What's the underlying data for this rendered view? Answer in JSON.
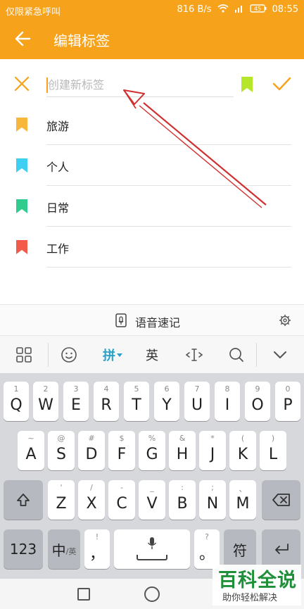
{
  "status_bar": {
    "left_text": "仅限紧急呼叫",
    "speed": "816 B/s",
    "battery": "45",
    "time": "08:55"
  },
  "app_bar": {
    "title": "编辑标签"
  },
  "new_tag": {
    "placeholder": "创建新标签",
    "value": "",
    "flag_color": "#b6e62b"
  },
  "tags": [
    {
      "label": "旅游",
      "color": "#f8b73b"
    },
    {
      "label": "个人",
      "color": "#3dd0f2"
    },
    {
      "label": "日常",
      "color": "#30cc8f"
    },
    {
      "label": "工作",
      "color": "#f25a4c"
    }
  ],
  "voice_bar": {
    "label": "语音速记"
  },
  "ime_toolbar": {
    "pinyin": "拼",
    "english": "英"
  },
  "keyboard": {
    "row1": [
      {
        "hint": "1",
        "key": "Q"
      },
      {
        "hint": "2",
        "key": "W"
      },
      {
        "hint": "3",
        "key": "E"
      },
      {
        "hint": "4",
        "key": "R"
      },
      {
        "hint": "5",
        "key": "T"
      },
      {
        "hint": "6",
        "key": "Y"
      },
      {
        "hint": "7",
        "key": "U"
      },
      {
        "hint": "8",
        "key": "I"
      },
      {
        "hint": "9",
        "key": "O"
      },
      {
        "hint": "0",
        "key": "P"
      }
    ],
    "row2": [
      {
        "hint": "~",
        "key": "A"
      },
      {
        "hint": "@",
        "key": "S"
      },
      {
        "hint": "#",
        "key": "D"
      },
      {
        "hint": "$",
        "key": "F"
      },
      {
        "hint": "%",
        "key": "G"
      },
      {
        "hint": "&",
        "key": "H"
      },
      {
        "hint": "*",
        "key": "J"
      },
      {
        "hint": "(",
        "key": "K"
      },
      {
        "hint": ")",
        "key": "L"
      }
    ],
    "row3": [
      {
        "hint": "'",
        "key": "Z"
      },
      {
        "hint": "/",
        "key": "X"
      },
      {
        "hint": "-",
        "key": "C"
      },
      {
        "hint": "_",
        "key": "V"
      },
      {
        "hint": ":",
        "key": "B"
      },
      {
        "hint": ";",
        "key": "N"
      },
      {
        "hint": "、",
        "key": "M"
      }
    ],
    "num_key": "123",
    "lang_key_main": "中",
    "lang_key_sub": "/英",
    "comma_hint": "!",
    "comma_key": "，",
    "period_hint": "?",
    "period_key": "。",
    "symbol_key": "符"
  },
  "watermark": {
    "big": "百科全说",
    "small": "助你轻松解决"
  },
  "colors": {
    "accent": "#f7a21b",
    "arrow": "#d0302f"
  }
}
